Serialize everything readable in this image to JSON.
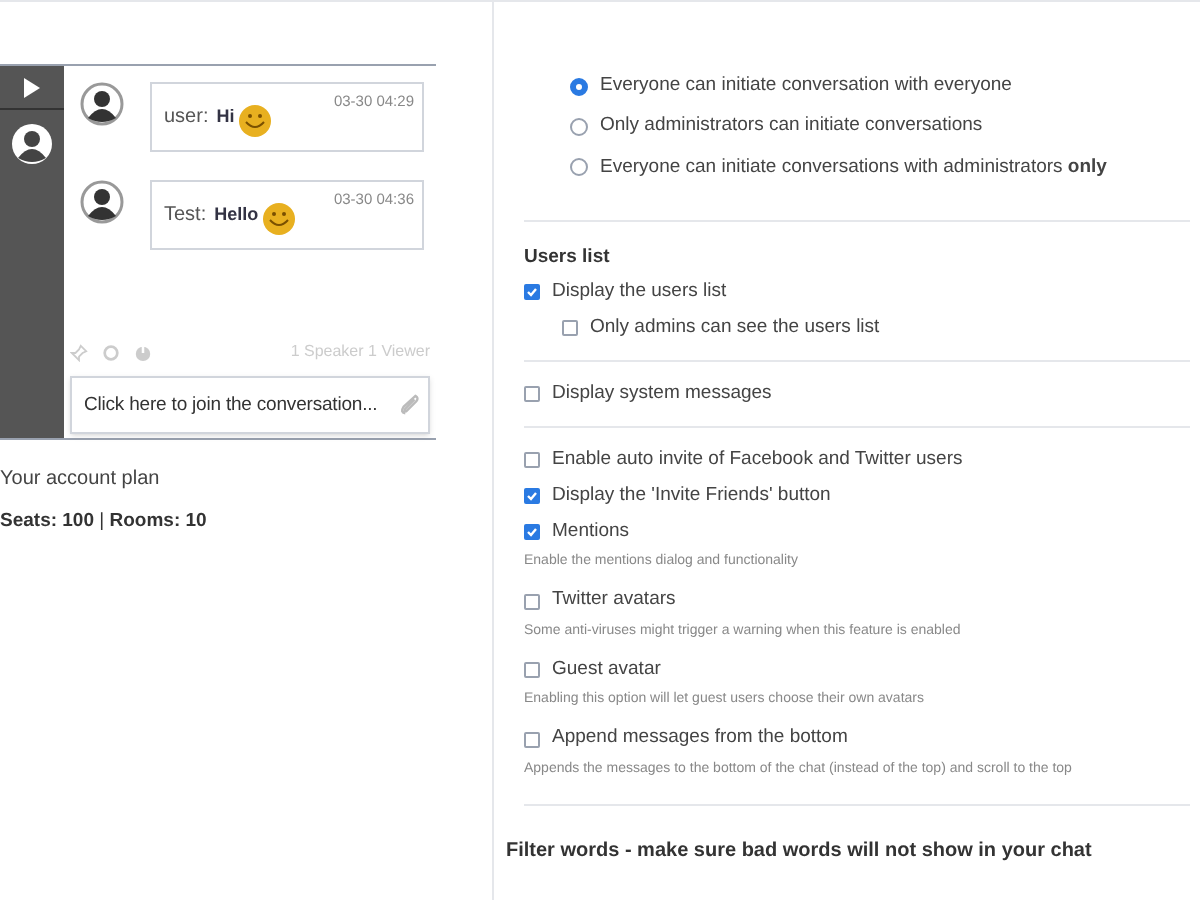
{
  "chat": {
    "messages": [
      {
        "author": "user:",
        "text": "Hi",
        "time": "03-30 04:29"
      },
      {
        "author": "Test:",
        "text": "Hello",
        "time": "03-30 04:36"
      }
    ],
    "footer_status": "1 Speaker 1 Viewer",
    "join_field": {
      "placeholder": "Click here to join the conversation..."
    }
  },
  "account": {
    "title": "Your account plan",
    "plan": "**Seats: 100** | **Rooms: 10**"
  },
  "settings": {
    "radios": [
      {
        "label": "Everyone can initiate conversation with everyone",
        "selected": true
      },
      {
        "label": "Only administrators can initiate conversations",
        "selected": false
      },
      {
        "label": "Everyone can initiate conversations with administrators **only**",
        "selected": false
      }
    ],
    "items": [
      {
        "kind": "divider"
      },
      {
        "kind": "heading",
        "text": "Users list"
      },
      {
        "kind": "checkbox",
        "label": "Display the users list",
        "checked": true,
        "children": [
          {
            "kind": "checkbox",
            "label": "Only admins can see the users list",
            "checked": false
          }
        ]
      },
      {
        "kind": "divider"
      },
      {
        "kind": "checkbox",
        "label": "Display system messages",
        "checked": false
      },
      {
        "kind": "divider"
      },
      {
        "kind": "checkbox",
        "label": "Enable auto invite of Facebook and Twitter users",
        "checked": false
      },
      {
        "kind": "checkbox",
        "label": "Display the 'Invite Friends' button",
        "checked": true
      },
      {
        "kind": "checkbox",
        "label": "Mentions",
        "checked": true,
        "hint": "Enable the mentions dialog and functionality"
      },
      {
        "kind": "checkbox",
        "label": "Twitter avatars",
        "checked": false,
        "hint": "Some anti-viruses might trigger a warning when this feature is enabled"
      },
      {
        "kind": "checkbox",
        "label": "Guest avatar",
        "checked": false,
        "hint": "Enabling this option will let guest users choose their own avatars"
      },
      {
        "kind": "checkbox",
        "label": "Append messages from the bottom",
        "checked": false,
        "hint": "Appends the messages to the bottom of the chat (instead of the top) and scroll to the top"
      },
      {
        "kind": "divider"
      },
      {
        "kind": "section_title",
        "text": "Filter words - make sure bad words will not show in your chat"
      }
    ]
  }
}
